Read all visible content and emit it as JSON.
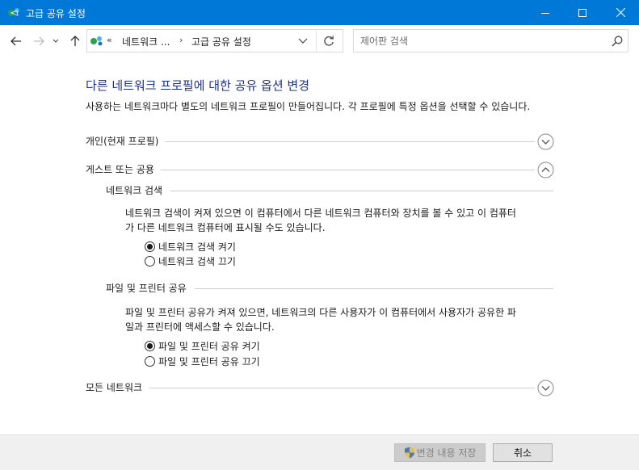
{
  "window": {
    "title": "고급 공유 설정"
  },
  "address": {
    "more": "«",
    "crumb1": "네트워크 ...",
    "separator": "›",
    "crumb2": "고급 공유 설정"
  },
  "search": {
    "placeholder": "제어판 검색"
  },
  "content": {
    "heading": "다른 네트워크 프로필에 대한 공유 옵션 변경",
    "description": "사용하는 네트워크마다 별도의 네트워크 프로필이 만들어집니다. 각 프로필에 특정 옵션을 선택할 수 있습니다.",
    "sections": {
      "private": {
        "label": "개인(현재 프로필)",
        "expanded": false
      },
      "guest": {
        "label": "게스트 또는 공용",
        "expanded": true
      },
      "all": {
        "label": "모든 네트워크",
        "expanded": false
      }
    },
    "network_discovery": {
      "label": "네트워크 검색",
      "text_line1": "네트워크 검색이 켜져 있으면 이 컴퓨터에서 다른 네트워크 컴퓨터와 장치를 볼 수 있고 이 컴퓨터",
      "text_line2": "가 다른 네트워크 컴퓨터에 표시될 수도 있습니다.",
      "option_on": "네트워크 검색 켜기",
      "option_off": "네트워크 검색 끄기",
      "selected": "on"
    },
    "file_sharing": {
      "label": "파일 및 프린터 공유",
      "text_line1": "파일 및 프린터 공유가 켜져 있으면, 네트워크의 다른 사용자가 이 컴퓨터에서 사용자가 공유한 파",
      "text_line2": "일과 프린터에 액세스할 수 있습니다.",
      "option_on": "파일 및 프린터 공유 켜기",
      "option_off": "파일 및 프린터 공유 끄기",
      "selected": "on"
    }
  },
  "footer": {
    "save_label": "변경 내용 저장",
    "save_enabled": false,
    "cancel_label": "취소"
  },
  "colors": {
    "titlebar": "#0078d7",
    "heading": "#1e3287"
  }
}
